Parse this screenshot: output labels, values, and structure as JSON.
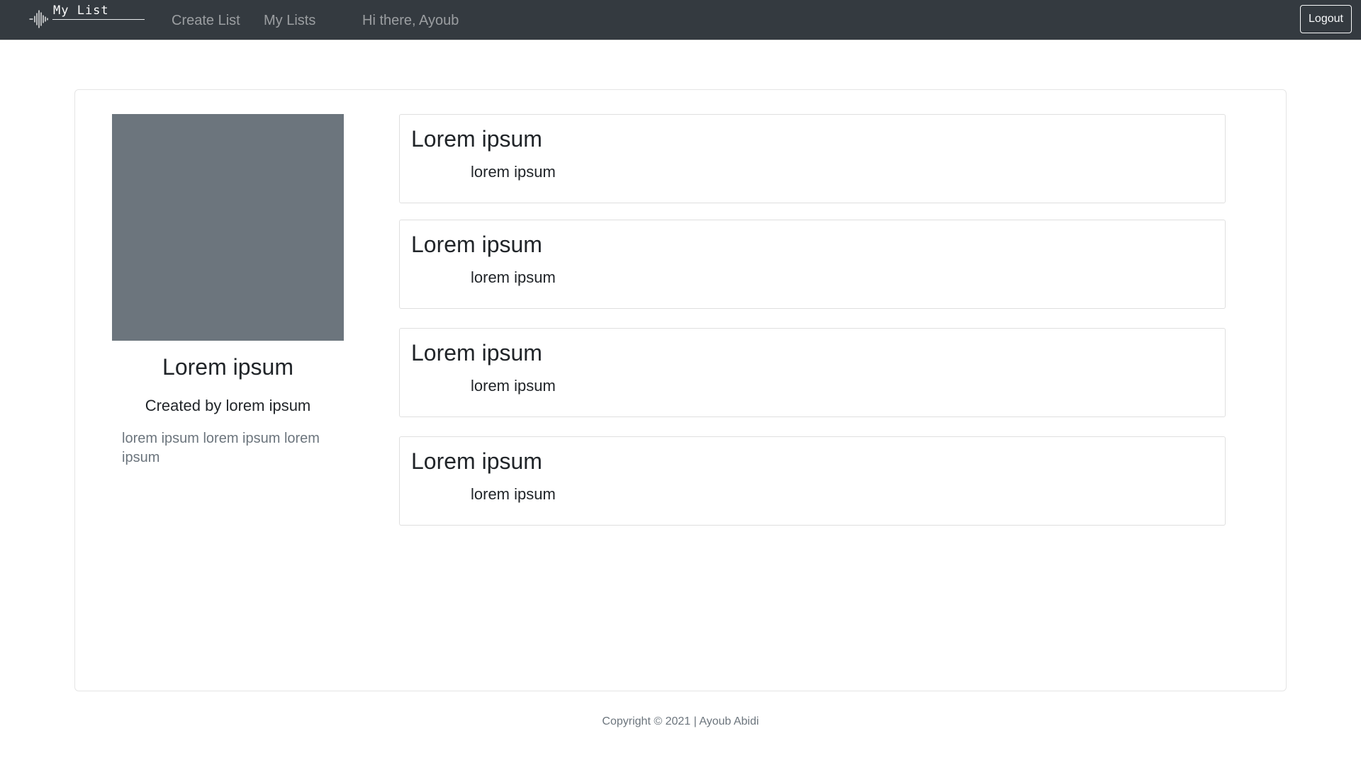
{
  "navbar": {
    "brand_text": "My List",
    "links": [
      "Create List",
      "My Lists"
    ],
    "greeting": "Hi there, Ayoub",
    "logout_label": "Logout"
  },
  "list": {
    "title": "Lorem ipsum",
    "author": "Created by lorem ipsum",
    "description": "lorem ipsum lorem ipsum lorem ipsum"
  },
  "items": [
    {
      "title": "Lorem ipsum",
      "subtitle": "lorem ipsum"
    },
    {
      "title": "Lorem ipsum",
      "subtitle": "lorem ipsum"
    },
    {
      "title": "Lorem ipsum",
      "subtitle": "lorem ipsum"
    },
    {
      "title": "Lorem ipsum",
      "subtitle": "lorem ipsum"
    }
  ],
  "footer": {
    "copyright": "Copyright © 2021 | Ayoub Abidi"
  },
  "colors": {
    "navbar": "#343a40",
    "cover_placeholder": "#6c757d",
    "muted_text": "#6c757d"
  }
}
